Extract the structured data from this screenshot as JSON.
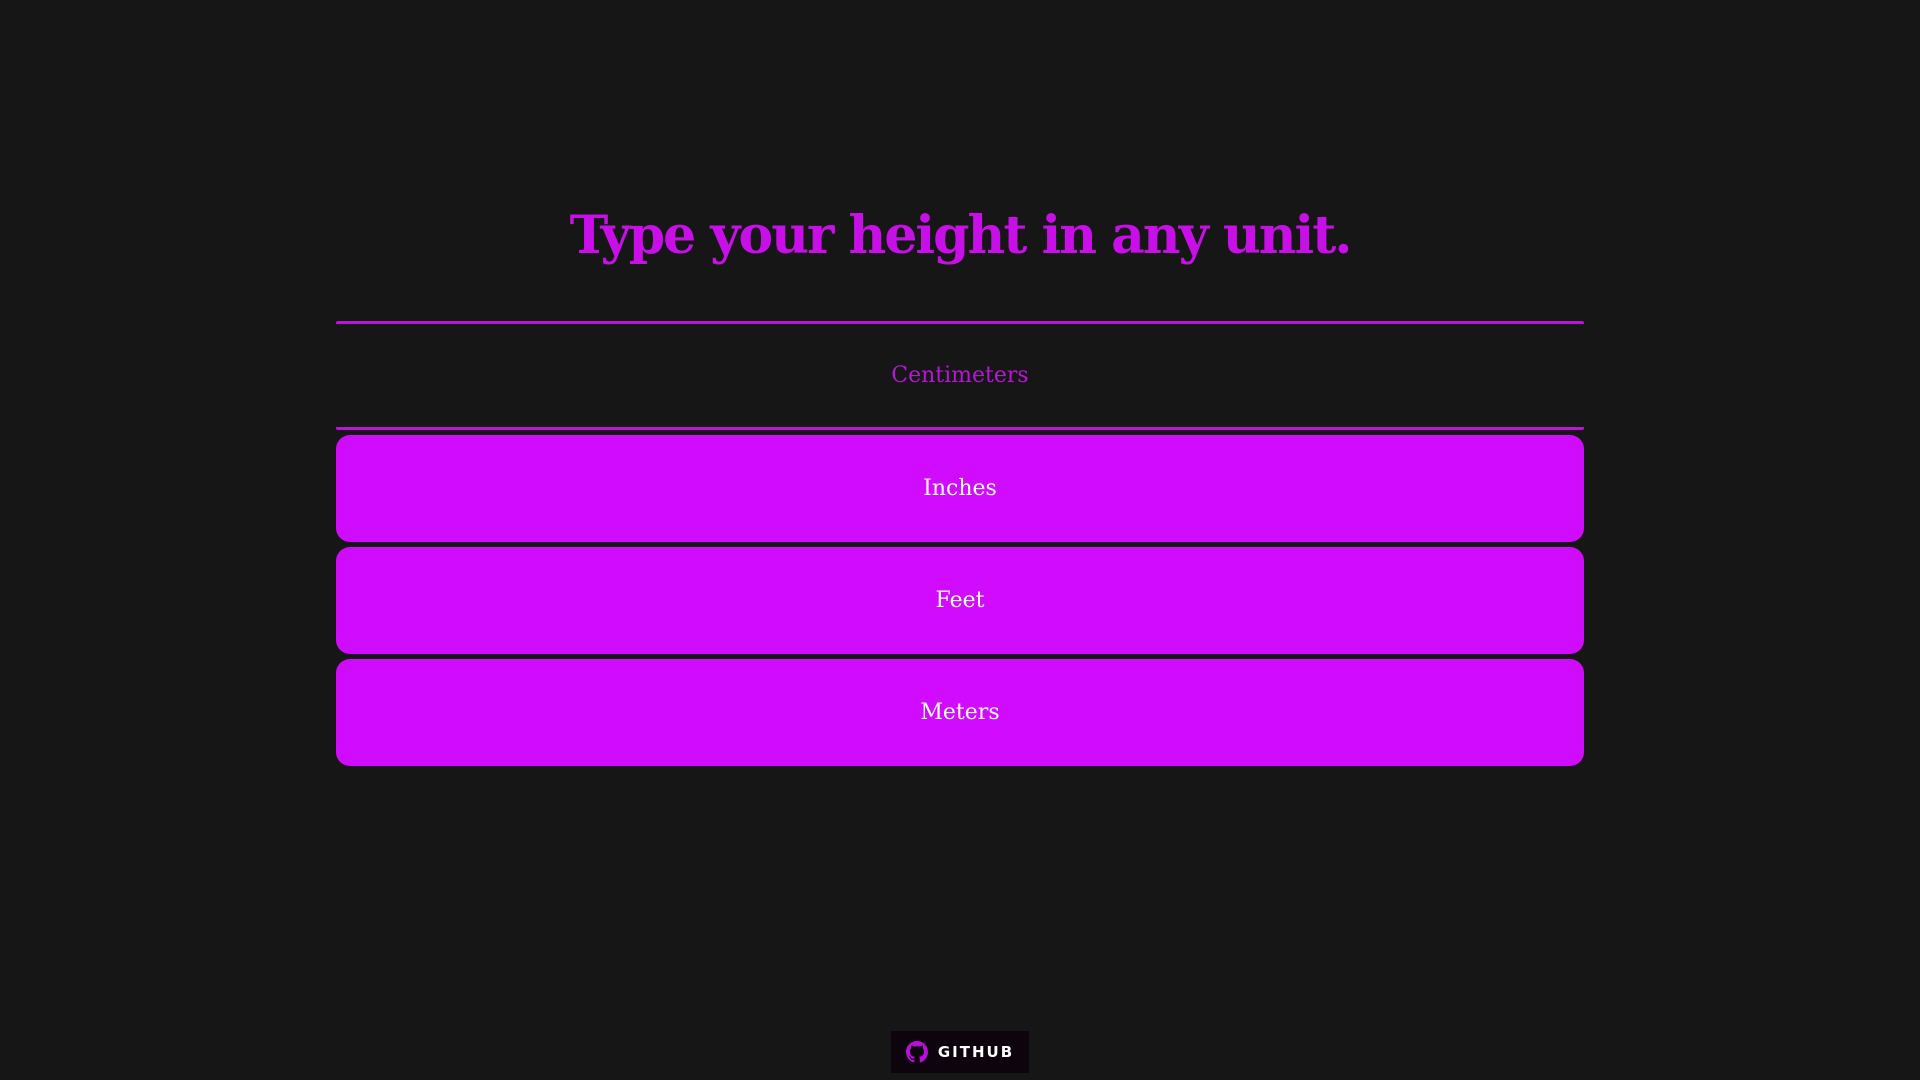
{
  "page": {
    "title": "Type your height in any unit."
  },
  "units": {
    "centimeters": "Centimeters",
    "inches": "Inches",
    "feet": "Feet",
    "meters": "Meters"
  },
  "footer": {
    "github_label": "GITHUB",
    "github_icon": "github-icon"
  },
  "colors": {
    "background": "#161616",
    "accent": "#d10bfd",
    "title": "#c80fe8",
    "field_border": "#b815d6",
    "button_text": "#ffffff"
  }
}
